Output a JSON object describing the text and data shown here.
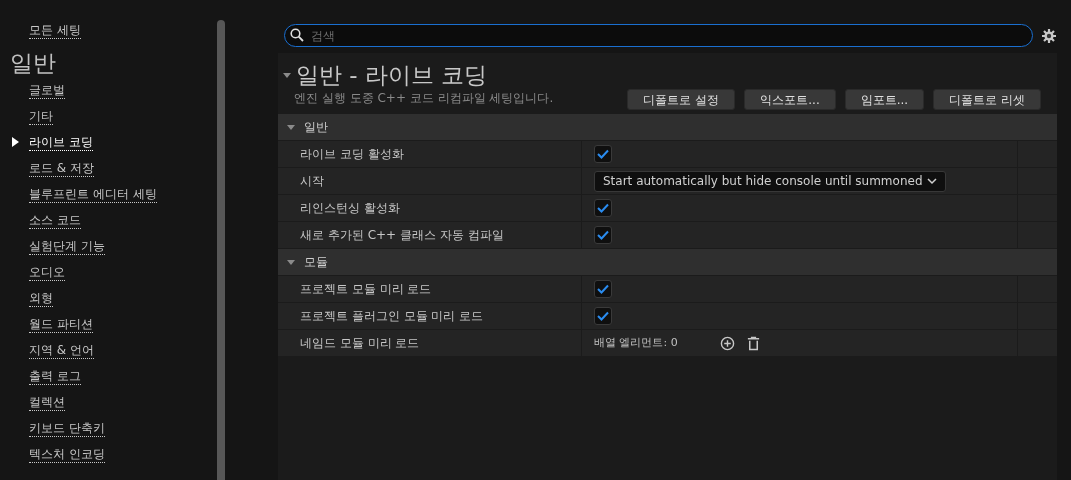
{
  "sidebar": {
    "all_settings": "모든 세팅",
    "section_title": "일반",
    "items": [
      {
        "label": "글로벌",
        "selected": false
      },
      {
        "label": "기타",
        "selected": false
      },
      {
        "label": "라이브 코딩",
        "selected": true
      },
      {
        "label": "로드 & 저장",
        "selected": false
      },
      {
        "label": "블루프린트 에디터 세팅",
        "selected": false
      },
      {
        "label": "소스 코드",
        "selected": false
      },
      {
        "label": "실험단계 기능",
        "selected": false
      },
      {
        "label": "오디오",
        "selected": false
      },
      {
        "label": "외형",
        "selected": false
      },
      {
        "label": "월드 파티션",
        "selected": false
      },
      {
        "label": "지역 & 언어",
        "selected": false
      },
      {
        "label": "출력 로그",
        "selected": false
      },
      {
        "label": "컬렉션",
        "selected": false
      },
      {
        "label": "키보드 단축키",
        "selected": false
      },
      {
        "label": "텍스처 인코딩",
        "selected": false
      }
    ]
  },
  "search": {
    "placeholder": "검색"
  },
  "page": {
    "title": "일반 - 라이브 코딩",
    "description": "엔진 실행 도중 C++ 코드 리컴파일 세팅입니다.",
    "buttons": [
      "디폴트로 설정",
      "익스포트...",
      "임포트...",
      "디폴트로 리셋"
    ]
  },
  "groups": [
    {
      "title": "일반",
      "expanded": true,
      "rows": [
        {
          "label": "라이브 코딩 활성화",
          "kind": "checkbox",
          "checked": true
        },
        {
          "label": "시작",
          "kind": "dropdown",
          "value": "Start automatically but hide console until summoned"
        },
        {
          "label": "리인스턴싱 활성화",
          "kind": "checkbox",
          "checked": true
        },
        {
          "label": "새로 추가된 C++ 클래스 자동 컴파일",
          "kind": "checkbox",
          "checked": true
        }
      ]
    },
    {
      "title": "모듈",
      "expanded": true,
      "rows": [
        {
          "label": "프로젝트 모듈 미리 로드",
          "kind": "checkbox",
          "checked": true
        },
        {
          "label": "프로젝트 플러그인 모듈 미리 로드",
          "kind": "checkbox",
          "checked": true
        },
        {
          "label": "네임드 모듈 미리 로드",
          "kind": "array",
          "value": "배열 엘리먼트: 0"
        }
      ]
    }
  ]
}
